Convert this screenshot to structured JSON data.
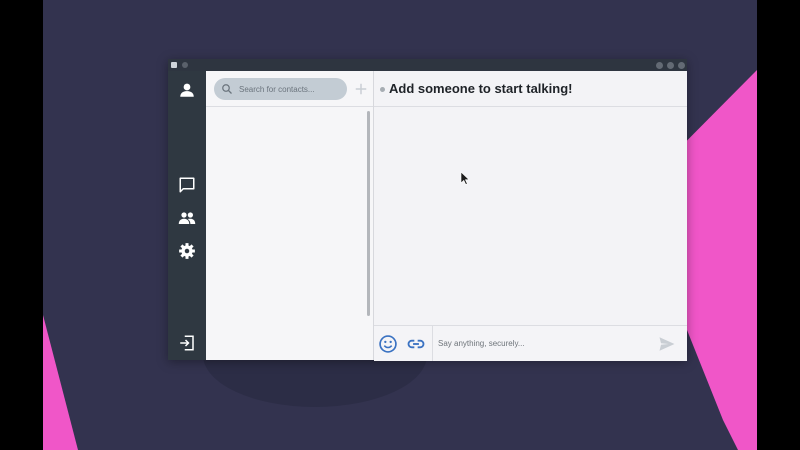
{
  "colors": {
    "background": "#33334f",
    "accent_pink": "#f056c8",
    "sidebar": "#2f3841",
    "icon_blue": "#3a72c2"
  },
  "sidebar": {
    "top": {
      "icon": "user-icon"
    },
    "items": [
      {
        "icon": "chat-icon"
      },
      {
        "icon": "contacts-icon"
      },
      {
        "icon": "gear-icon"
      }
    ],
    "bottom": {
      "icon": "logout-icon"
    }
  },
  "contacts": {
    "search_placeholder": "Search for contacts...",
    "add_icon": "plus-icon"
  },
  "chat": {
    "title": "Add someone to start talking!",
    "composer_placeholder": "Say anything, securely...",
    "emoji_icon": "emoji-icon",
    "attach_icon": "link-icon",
    "send_icon": "send-icon"
  }
}
